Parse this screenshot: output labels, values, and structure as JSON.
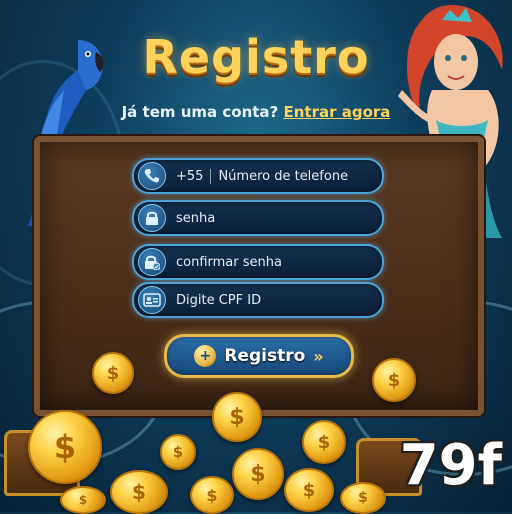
{
  "header": {
    "title": "Registro",
    "subtitle_prefix": "Já tem uma conta?",
    "login_link": "Entrar agora"
  },
  "form": {
    "phone_code": "+55",
    "phone_placeholder": "Número de telefone",
    "password_placeholder": "senha",
    "confirm_password_placeholder": "confirmar senha",
    "cpf_placeholder": "Digite CPF ID"
  },
  "submit": {
    "label": "Registro"
  },
  "brand": {
    "label": "79f"
  },
  "icons": {
    "phone": "phone-icon",
    "password": "lock-icon",
    "confirm_password": "lock-check-icon",
    "cpf": "id-card-icon",
    "submit": "coin-plus-icon",
    "arrows": "double-chevron-right-icon"
  },
  "colors": {
    "title": "#ffd35a",
    "field_border": "#4fa3d8",
    "button_bg": "#1f5c94",
    "button_border": "#e8b84a",
    "board": "#4a2e1a"
  }
}
